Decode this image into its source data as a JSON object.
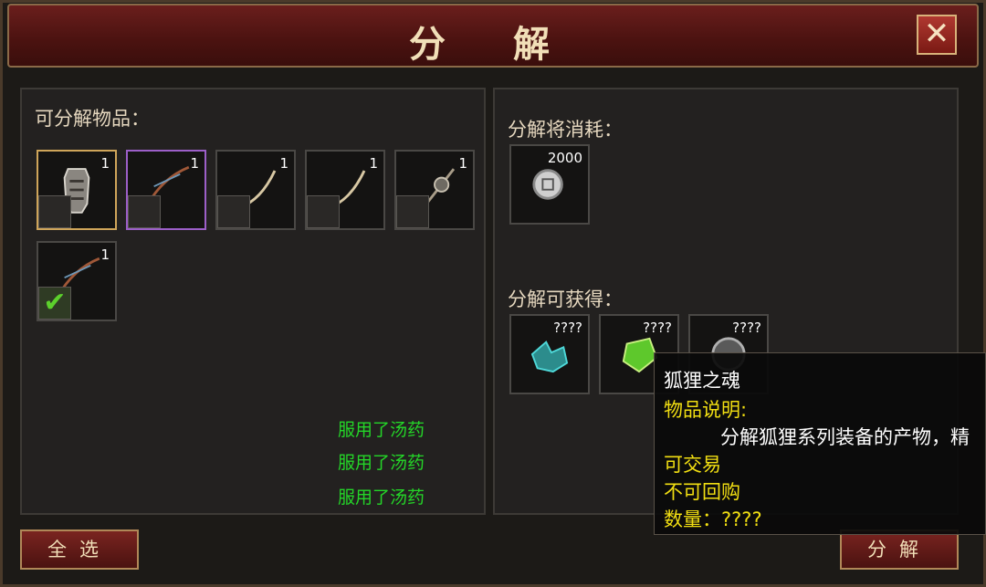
{
  "window": {
    "title": "分 解",
    "close_glyph": "✕"
  },
  "left_panel": {
    "label": "可分解物品：",
    "items": [
      {
        "qty": "1",
        "icon": "armor-icon",
        "checked": false
      },
      {
        "qty": "1",
        "icon": "bow-icon",
        "checked": false
      },
      {
        "qty": "1",
        "icon": "bow-icon",
        "checked": false
      },
      {
        "qty": "1",
        "icon": "bow-icon",
        "checked": false
      },
      {
        "qty": "1",
        "icon": "axe-icon",
        "checked": false
      },
      {
        "qty": "1",
        "icon": "bow-icon",
        "checked": true
      }
    ],
    "log": [
      "服用了汤药",
      "服用了汤药",
      "服用了汤药"
    ]
  },
  "right_panel": {
    "consume_label": "分解将消耗：",
    "consume_item": {
      "qty": "2000",
      "icon": "coin-icon"
    },
    "obtain_label": "分解可获得：",
    "obtain_items": [
      {
        "qty": "????",
        "icon": "crystal-icon"
      },
      {
        "qty": "????",
        "icon": "gem-icon"
      },
      {
        "qty": "????",
        "icon": "soul-icon"
      }
    ]
  },
  "tooltip": {
    "name": "狐狸之魂",
    "desc_label": "物品说明:",
    "desc": "分解狐狸系列装备的产物，精",
    "tradable": "可交易",
    "buyback": "不可回购",
    "qty": "数量：????"
  },
  "buttons": {
    "select_all": "全选",
    "decompose": "分解"
  },
  "colors": {
    "accent": "#f2df12",
    "log": "#24d628",
    "title_bar": "#4a1210"
  }
}
